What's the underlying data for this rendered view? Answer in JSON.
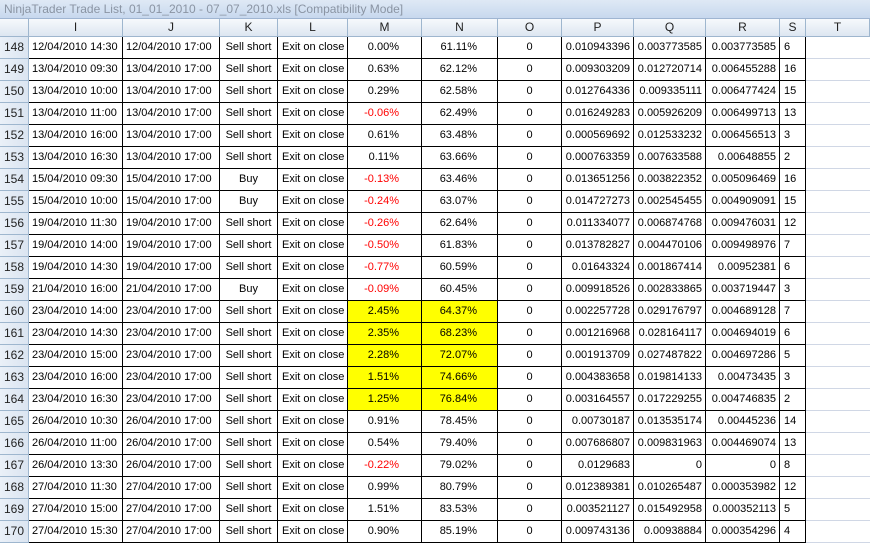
{
  "window": {
    "title": "NinjaTrader Trade List, 01_01_2010 - 07_07_2010.xls  [Compatibility Mode]"
  },
  "columns": [
    "I",
    "J",
    "K",
    "L",
    "M",
    "N",
    "O",
    "P",
    "Q",
    "R",
    "S",
    "T"
  ],
  "colors": {
    "negative": "#ff0000",
    "highlight": "#ffff00",
    "header_bg": "#dde6f1"
  },
  "rows": [
    {
      "n": "148",
      "i": "12/04/2010 14:30",
      "j": "12/04/2010 17:00",
      "k": "Sell short",
      "l": "Exit on close",
      "m": "0.00%",
      "n_val": "61.11%",
      "o": "0",
      "p": "0.010943396",
      "q": "0.003773585",
      "r": "0.003773585",
      "s": "6",
      "neg": false,
      "hl": false
    },
    {
      "n": "149",
      "i": "13/04/2010 09:30",
      "j": "13/04/2010 17:00",
      "k": "Sell short",
      "l": "Exit on close",
      "m": "0.63%",
      "n_val": "62.12%",
      "o": "0",
      "p": "0.009303209",
      "q": "0.012720714",
      "r": "0.006455288",
      "s": "16",
      "neg": false,
      "hl": false
    },
    {
      "n": "150",
      "i": "13/04/2010 10:00",
      "j": "13/04/2010 17:00",
      "k": "Sell short",
      "l": "Exit on close",
      "m": "0.29%",
      "n_val": "62.58%",
      "o": "0",
      "p": "0.012764336",
      "q": "0.009335111",
      "r": "0.006477424",
      "s": "15",
      "neg": false,
      "hl": false
    },
    {
      "n": "151",
      "i": "13/04/2010 11:00",
      "j": "13/04/2010 17:00",
      "k": "Sell short",
      "l": "Exit on close",
      "m": "-0.06%",
      "n_val": "62.49%",
      "o": "0",
      "p": "0.016249283",
      "q": "0.005926209",
      "r": "0.006499713",
      "s": "13",
      "neg": true,
      "hl": false
    },
    {
      "n": "152",
      "i": "13/04/2010 16:00",
      "j": "13/04/2010 17:00",
      "k": "Sell short",
      "l": "Exit on close",
      "m": "0.61%",
      "n_val": "63.48%",
      "o": "0",
      "p": "0.000569692",
      "q": "0.012533232",
      "r": "0.006456513",
      "s": "3",
      "neg": false,
      "hl": false
    },
    {
      "n": "153",
      "i": "13/04/2010 16:30",
      "j": "13/04/2010 17:00",
      "k": "Sell short",
      "l": "Exit on close",
      "m": "0.11%",
      "n_val": "63.66%",
      "o": "0",
      "p": "0.000763359",
      "q": "0.007633588",
      "r": "0.00648855",
      "s": "2",
      "neg": false,
      "hl": false
    },
    {
      "n": "154",
      "i": "15/04/2010 09:30",
      "j": "15/04/2010 17:00",
      "k": "Buy",
      "l": "Exit on close",
      "m": "-0.13%",
      "n_val": "63.46%",
      "o": "0",
      "p": "0.013651256",
      "q": "0.003822352",
      "r": "0.005096469",
      "s": "16",
      "neg": true,
      "hl": false
    },
    {
      "n": "155",
      "i": "15/04/2010 10:00",
      "j": "15/04/2010 17:00",
      "k": "Buy",
      "l": "Exit on close",
      "m": "-0.24%",
      "n_val": "63.07%",
      "o": "0",
      "p": "0.014727273",
      "q": "0.002545455",
      "r": "0.004909091",
      "s": "15",
      "neg": true,
      "hl": false
    },
    {
      "n": "156",
      "i": "19/04/2010 11:30",
      "j": "19/04/2010 17:00",
      "k": "Sell short",
      "l": "Exit on close",
      "m": "-0.26%",
      "n_val": "62.64%",
      "o": "0",
      "p": "0.011334077",
      "q": "0.006874768",
      "r": "0.009476031",
      "s": "12",
      "neg": true,
      "hl": false
    },
    {
      "n": "157",
      "i": "19/04/2010 14:00",
      "j": "19/04/2010 17:00",
      "k": "Sell short",
      "l": "Exit on close",
      "m": "-0.50%",
      "n_val": "61.83%",
      "o": "0",
      "p": "0.013782827",
      "q": "0.004470106",
      "r": "0.009498976",
      "s": "7",
      "neg": true,
      "hl": false
    },
    {
      "n": "158",
      "i": "19/04/2010 14:30",
      "j": "19/04/2010 17:00",
      "k": "Sell short",
      "l": "Exit on close",
      "m": "-0.77%",
      "n_val": "60.59%",
      "o": "0",
      "p": "0.01643324",
      "q": "0.001867414",
      "r": "0.00952381",
      "s": "6",
      "neg": true,
      "hl": false
    },
    {
      "n": "159",
      "i": "21/04/2010 16:00",
      "j": "21/04/2010 17:00",
      "k": "Buy",
      "l": "Exit on close",
      "m": "-0.09%",
      "n_val": "60.45%",
      "o": "0",
      "p": "0.009918526",
      "q": "0.002833865",
      "r": "0.003719447",
      "s": "3",
      "neg": true,
      "hl": false
    },
    {
      "n": "160",
      "i": "23/04/2010 14:00",
      "j": "23/04/2010 17:00",
      "k": "Sell short",
      "l": "Exit on close",
      "m": "2.45%",
      "n_val": "64.37%",
      "o": "0",
      "p": "0.002257728",
      "q": "0.029176797",
      "r": "0.004689128",
      "s": "7",
      "neg": false,
      "hl": true
    },
    {
      "n": "161",
      "i": "23/04/2010 14:30",
      "j": "23/04/2010 17:00",
      "k": "Sell short",
      "l": "Exit on close",
      "m": "2.35%",
      "n_val": "68.23%",
      "o": "0",
      "p": "0.001216968",
      "q": "0.028164117",
      "r": "0.004694019",
      "s": "6",
      "neg": false,
      "hl": true
    },
    {
      "n": "162",
      "i": "23/04/2010 15:00",
      "j": "23/04/2010 17:00",
      "k": "Sell short",
      "l": "Exit on close",
      "m": "2.28%",
      "n_val": "72.07%",
      "o": "0",
      "p": "0.001913709",
      "q": "0.027487822",
      "r": "0.004697286",
      "s": "5",
      "neg": false,
      "hl": true
    },
    {
      "n": "163",
      "i": "23/04/2010 16:00",
      "j": "23/04/2010 17:00",
      "k": "Sell short",
      "l": "Exit on close",
      "m": "1.51%",
      "n_val": "74.66%",
      "o": "0",
      "p": "0.004383658",
      "q": "0.019814133",
      "r": "0.00473435",
      "s": "3",
      "neg": false,
      "hl": true
    },
    {
      "n": "164",
      "i": "23/04/2010 16:30",
      "j": "23/04/2010 17:00",
      "k": "Sell short",
      "l": "Exit on close",
      "m": "1.25%",
      "n_val": "76.84%",
      "o": "0",
      "p": "0.003164557",
      "q": "0.017229255",
      "r": "0.004746835",
      "s": "2",
      "neg": false,
      "hl": true
    },
    {
      "n": "165",
      "i": "26/04/2010 10:30",
      "j": "26/04/2010 17:00",
      "k": "Sell short",
      "l": "Exit on close",
      "m": "0.91%",
      "n_val": "78.45%",
      "o": "0",
      "p": "0.00730187",
      "q": "0.013535174",
      "r": "0.00445236",
      "s": "14",
      "neg": false,
      "hl": false
    },
    {
      "n": "166",
      "i": "26/04/2010 11:00",
      "j": "26/04/2010 17:00",
      "k": "Sell short",
      "l": "Exit on close",
      "m": "0.54%",
      "n_val": "79.40%",
      "o": "0",
      "p": "0.007686807",
      "q": "0.009831963",
      "r": "0.004469074",
      "s": "13",
      "neg": false,
      "hl": false
    },
    {
      "n": "167",
      "i": "26/04/2010 13:30",
      "j": "26/04/2010 17:00",
      "k": "Sell short",
      "l": "Exit on close",
      "m": "-0.22%",
      "n_val": "79.02%",
      "o": "0",
      "p": "0.0129683",
      "q": "0",
      "r": "0",
      "s": "8",
      "neg": true,
      "hl": false
    },
    {
      "n": "168",
      "i": "27/04/2010 11:30",
      "j": "27/04/2010 17:00",
      "k": "Sell short",
      "l": "Exit on close",
      "m": "0.99%",
      "n_val": "80.79%",
      "o": "0",
      "p": "0.012389381",
      "q": "0.010265487",
      "r": "0.000353982",
      "s": "12",
      "neg": false,
      "hl": false
    },
    {
      "n": "169",
      "i": "27/04/2010 15:00",
      "j": "27/04/2010 17:00",
      "k": "Sell short",
      "l": "Exit on close",
      "m": "1.51%",
      "n_val": "83.53%",
      "o": "0",
      "p": "0.003521127",
      "q": "0.015492958",
      "r": "0.000352113",
      "s": "5",
      "neg": false,
      "hl": false
    },
    {
      "n": "170",
      "i": "27/04/2010 15:30",
      "j": "27/04/2010 17:00",
      "k": "Sell short",
      "l": "Exit on close",
      "m": "0.90%",
      "n_val": "85.19%",
      "o": "0",
      "p": "0.009743136",
      "q": "0.00938884",
      "r": "0.000354296",
      "s": "4",
      "neg": false,
      "hl": false
    }
  ]
}
